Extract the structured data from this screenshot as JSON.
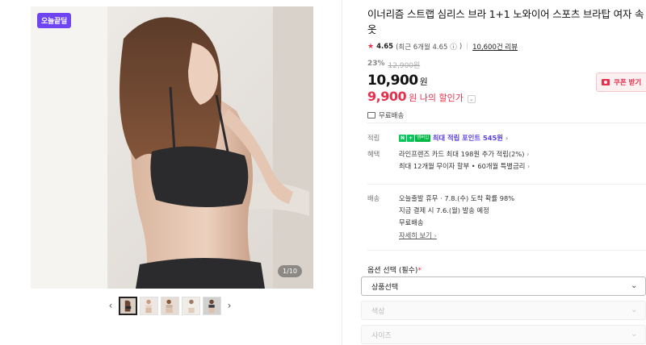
{
  "product": {
    "title": "이너리즘 스트랩 심리스 브라 1+1 노와이어 스포츠 브라탑 여자 속옷",
    "promo_badge": "오늘끝딜",
    "image_counter": "1/10"
  },
  "rating": {
    "value": "4.65",
    "recent": "(최근 6개월 4.65",
    "info_icon": "ⓘ",
    "recent_close": ")",
    "reviews": "10,600건 리뷰"
  },
  "pricing": {
    "discount_rate": "23%",
    "original_price": "12,900원",
    "price": "10,900",
    "price_unit": "원",
    "my_price": "9,900",
    "my_price_label": "원 나의 할인가",
    "coupon_label": "쿠폰 받기"
  },
  "shipping_summary": "무료배송",
  "points": {
    "label": "적립",
    "badge_n": "N",
    "badge_plus": "+",
    "badge_membership": "멤버십",
    "text": "최대 적립 포인트 545원"
  },
  "benefits": {
    "label": "혜택",
    "line1": "라인프렌즈 카드 최대 198원 추가 적립(2%)",
    "line2": "최대 12개월 무이자 할부 • 60개월 특별금리"
  },
  "delivery": {
    "label": "배송",
    "line1": "오늘출발 휴무 · 7.8.(수) 도착 확률 98%",
    "line2": "지금 결제 시 7.6.(월) 발송 예정",
    "line3": "무료배송",
    "detail_link": "자세히 보기"
  },
  "options": {
    "title": "옵션 선택 (필수)",
    "required_mark": "*",
    "selects": [
      {
        "label": "상품선택"
      },
      {
        "label": "색상"
      },
      {
        "label": "사이즈"
      }
    ]
  },
  "icons": {
    "chevron_right": "›",
    "chevron_left": "‹",
    "chevron_down": "⌄",
    "star": "★"
  },
  "colors": {
    "accent_red": "#e8304d",
    "promo_purple": "#6f44f2",
    "point_purple": "#5a3fe0",
    "naver_green": "#03c75a"
  }
}
